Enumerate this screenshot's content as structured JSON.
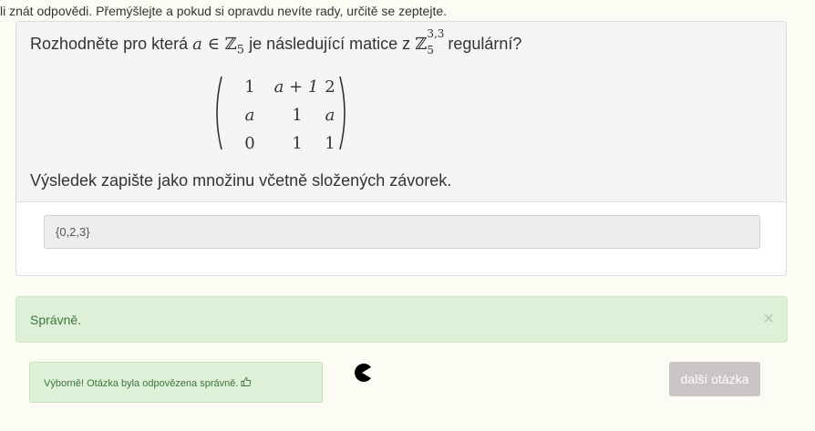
{
  "intro_text": "li znát odpovědi. Přemýšlejte a pokud si opravdu nevíte rady, určitě se zeptejte.",
  "question": {
    "prefix": "Rozhodněte pro která",
    "var": "a",
    "in_symbol": "∈",
    "ring": "ℤ",
    "ring_sub": "5",
    "middle": "je následující matice z",
    "matrix_space": "ℤ",
    "matrix_space_sup": "3,3",
    "matrix_space_sub": "5",
    "suffix": "regulární?",
    "hint": "Výsledek zapište jako množinu včetně složených závorek."
  },
  "matrix": {
    "rows": [
      [
        "1",
        "a + 1",
        "2"
      ],
      [
        "a",
        "1",
        "a"
      ],
      [
        "0",
        "1",
        "1"
      ]
    ]
  },
  "answer": {
    "value": "{0,2,3}"
  },
  "feedback": {
    "result": "Správně.",
    "close_symbol": "×",
    "detail": "Výborně! Otázka byla odpovězena správně."
  },
  "buttons": {
    "next_label": "další otázka"
  },
  "colors": {
    "success_bg": "#dff0d8",
    "success_text": "#3c763d",
    "button_disabled": "#c9c5c5"
  },
  "icons": {
    "thumb": "thumbs-up-icon",
    "loader": "pacman-icon"
  }
}
